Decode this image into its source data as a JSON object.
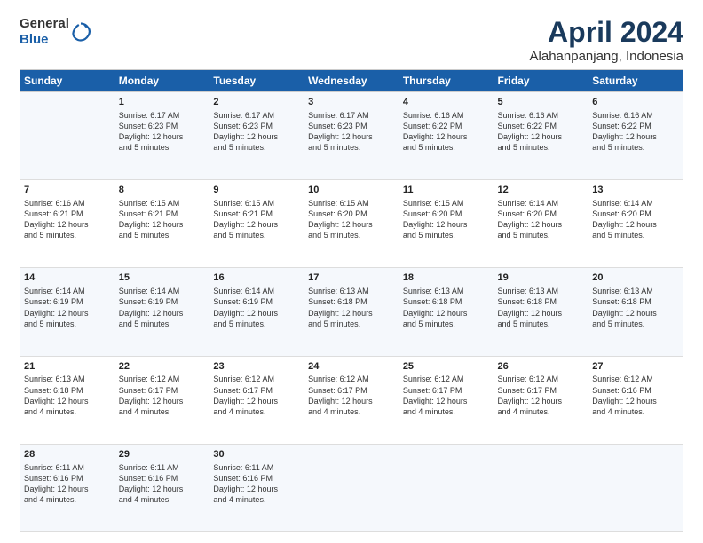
{
  "logo": {
    "general": "General",
    "blue": "Blue"
  },
  "header": {
    "title": "April 2024",
    "subtitle": "Alahanpanjang, Indonesia"
  },
  "columns": [
    "Sunday",
    "Monday",
    "Tuesday",
    "Wednesday",
    "Thursday",
    "Friday",
    "Saturday"
  ],
  "weeks": [
    [
      {
        "day": "",
        "info": ""
      },
      {
        "day": "1",
        "info": "Sunrise: 6:17 AM\nSunset: 6:23 PM\nDaylight: 12 hours\nand 5 minutes."
      },
      {
        "day": "2",
        "info": "Sunrise: 6:17 AM\nSunset: 6:23 PM\nDaylight: 12 hours\nand 5 minutes."
      },
      {
        "day": "3",
        "info": "Sunrise: 6:17 AM\nSunset: 6:23 PM\nDaylight: 12 hours\nand 5 minutes."
      },
      {
        "day": "4",
        "info": "Sunrise: 6:16 AM\nSunset: 6:22 PM\nDaylight: 12 hours\nand 5 minutes."
      },
      {
        "day": "5",
        "info": "Sunrise: 6:16 AM\nSunset: 6:22 PM\nDaylight: 12 hours\nand 5 minutes."
      },
      {
        "day": "6",
        "info": "Sunrise: 6:16 AM\nSunset: 6:22 PM\nDaylight: 12 hours\nand 5 minutes."
      }
    ],
    [
      {
        "day": "7",
        "info": "Sunrise: 6:16 AM\nSunset: 6:21 PM\nDaylight: 12 hours\nand 5 minutes."
      },
      {
        "day": "8",
        "info": "Sunrise: 6:15 AM\nSunset: 6:21 PM\nDaylight: 12 hours\nand 5 minutes."
      },
      {
        "day": "9",
        "info": "Sunrise: 6:15 AM\nSunset: 6:21 PM\nDaylight: 12 hours\nand 5 minutes."
      },
      {
        "day": "10",
        "info": "Sunrise: 6:15 AM\nSunset: 6:20 PM\nDaylight: 12 hours\nand 5 minutes."
      },
      {
        "day": "11",
        "info": "Sunrise: 6:15 AM\nSunset: 6:20 PM\nDaylight: 12 hours\nand 5 minutes."
      },
      {
        "day": "12",
        "info": "Sunrise: 6:14 AM\nSunset: 6:20 PM\nDaylight: 12 hours\nand 5 minutes."
      },
      {
        "day": "13",
        "info": "Sunrise: 6:14 AM\nSunset: 6:20 PM\nDaylight: 12 hours\nand 5 minutes."
      }
    ],
    [
      {
        "day": "14",
        "info": "Sunrise: 6:14 AM\nSunset: 6:19 PM\nDaylight: 12 hours\nand 5 minutes."
      },
      {
        "day": "15",
        "info": "Sunrise: 6:14 AM\nSunset: 6:19 PM\nDaylight: 12 hours\nand 5 minutes."
      },
      {
        "day": "16",
        "info": "Sunrise: 6:14 AM\nSunset: 6:19 PM\nDaylight: 12 hours\nand 5 minutes."
      },
      {
        "day": "17",
        "info": "Sunrise: 6:13 AM\nSunset: 6:18 PM\nDaylight: 12 hours\nand 5 minutes."
      },
      {
        "day": "18",
        "info": "Sunrise: 6:13 AM\nSunset: 6:18 PM\nDaylight: 12 hours\nand 5 minutes."
      },
      {
        "day": "19",
        "info": "Sunrise: 6:13 AM\nSunset: 6:18 PM\nDaylight: 12 hours\nand 5 minutes."
      },
      {
        "day": "20",
        "info": "Sunrise: 6:13 AM\nSunset: 6:18 PM\nDaylight: 12 hours\nand 5 minutes."
      }
    ],
    [
      {
        "day": "21",
        "info": "Sunrise: 6:13 AM\nSunset: 6:18 PM\nDaylight: 12 hours\nand 4 minutes."
      },
      {
        "day": "22",
        "info": "Sunrise: 6:12 AM\nSunset: 6:17 PM\nDaylight: 12 hours\nand 4 minutes."
      },
      {
        "day": "23",
        "info": "Sunrise: 6:12 AM\nSunset: 6:17 PM\nDaylight: 12 hours\nand 4 minutes."
      },
      {
        "day": "24",
        "info": "Sunrise: 6:12 AM\nSunset: 6:17 PM\nDaylight: 12 hours\nand 4 minutes."
      },
      {
        "day": "25",
        "info": "Sunrise: 6:12 AM\nSunset: 6:17 PM\nDaylight: 12 hours\nand 4 minutes."
      },
      {
        "day": "26",
        "info": "Sunrise: 6:12 AM\nSunset: 6:17 PM\nDaylight: 12 hours\nand 4 minutes."
      },
      {
        "day": "27",
        "info": "Sunrise: 6:12 AM\nSunset: 6:16 PM\nDaylight: 12 hours\nand 4 minutes."
      }
    ],
    [
      {
        "day": "28",
        "info": "Sunrise: 6:11 AM\nSunset: 6:16 PM\nDaylight: 12 hours\nand 4 minutes."
      },
      {
        "day": "29",
        "info": "Sunrise: 6:11 AM\nSunset: 6:16 PM\nDaylight: 12 hours\nand 4 minutes."
      },
      {
        "day": "30",
        "info": "Sunrise: 6:11 AM\nSunset: 6:16 PM\nDaylight: 12 hours\nand 4 minutes."
      },
      {
        "day": "",
        "info": ""
      },
      {
        "day": "",
        "info": ""
      },
      {
        "day": "",
        "info": ""
      },
      {
        "day": "",
        "info": ""
      }
    ]
  ]
}
